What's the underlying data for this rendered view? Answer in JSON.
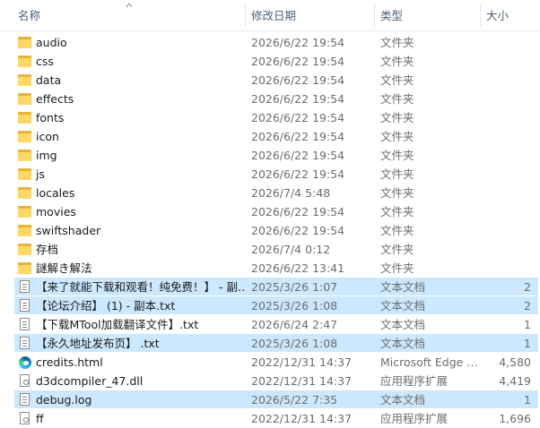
{
  "header": {
    "name": "名称",
    "date": "修改日期",
    "type": "类型",
    "size": "大小"
  },
  "files": [
    {
      "name": "audio",
      "date": "2026/6/22 19:54",
      "type": "文件夹",
      "size": "",
      "icon": "folder-icon",
      "selected": false
    },
    {
      "name": "css",
      "date": "2026/6/22 19:54",
      "type": "文件夹",
      "size": "",
      "icon": "folder-icon",
      "selected": false
    },
    {
      "name": "data",
      "date": "2026/6/22 19:54",
      "type": "文件夹",
      "size": "",
      "icon": "folder-icon",
      "selected": false
    },
    {
      "name": "effects",
      "date": "2026/6/22 19:54",
      "type": "文件夹",
      "size": "",
      "icon": "folder-icon",
      "selected": false
    },
    {
      "name": "fonts",
      "date": "2026/6/22 19:54",
      "type": "文件夹",
      "size": "",
      "icon": "folder-icon",
      "selected": false
    },
    {
      "name": "icon",
      "date": "2026/6/22 19:54",
      "type": "文件夹",
      "size": "",
      "icon": "folder-icon",
      "selected": false
    },
    {
      "name": "img",
      "date": "2026/6/22 19:54",
      "type": "文件夹",
      "size": "",
      "icon": "folder-icon",
      "selected": false
    },
    {
      "name": "js",
      "date": "2026/6/22 19:54",
      "type": "文件夹",
      "size": "",
      "icon": "folder-icon",
      "selected": false
    },
    {
      "name": "locales",
      "date": "2026/7/4 5:48",
      "type": "文件夹",
      "size": "",
      "icon": "folder-icon",
      "selected": false
    },
    {
      "name": "movies",
      "date": "2026/6/22 19:54",
      "type": "文件夹",
      "size": "",
      "icon": "folder-icon",
      "selected": false
    },
    {
      "name": "swiftshader",
      "date": "2026/6/22 19:54",
      "type": "文件夹",
      "size": "",
      "icon": "folder-icon",
      "selected": false
    },
    {
      "name": "存档",
      "date": "2026/7/4 0:12",
      "type": "文件夹",
      "size": "",
      "icon": "folder-icon",
      "selected": false
    },
    {
      "name": "謎解き解法",
      "date": "2026/6/22 13:41",
      "type": "文件夹",
      "size": "",
      "icon": "folder-icon",
      "selected": false
    },
    {
      "name": "【来了就能下载和观看！纯免费！】 - 副…",
      "date": "2025/3/26 1:07",
      "type": "文本文档",
      "size": "2",
      "icon": "text-file-icon",
      "selected": true
    },
    {
      "name": "【论坛介绍】 (1) - 副本.txt",
      "date": "2025/3/26 1:08",
      "type": "文本文档",
      "size": "2",
      "icon": "text-file-icon",
      "selected": true
    },
    {
      "name": "【下载MTool加载翻译文件】.txt",
      "date": "2026/6/24 2:47",
      "type": "文本文档",
      "size": "1",
      "icon": "text-file-icon",
      "selected": false
    },
    {
      "name": "【永久地址发布页】 .txt",
      "date": "2025/3/26 1:08",
      "type": "文本文档",
      "size": "1",
      "icon": "text-file-icon",
      "selected": true
    },
    {
      "name": "credits.html",
      "date": "2022/12/31 14:37",
      "type": "Microsoft Edge …",
      "size": "4,580",
      "icon": "edge-icon",
      "selected": false
    },
    {
      "name": "d3dcompiler_47.dll",
      "date": "2022/12/31 14:37",
      "type": "应用程序扩展",
      "size": "4,419",
      "icon": "dll-file-icon",
      "selected": false
    },
    {
      "name": "debug.log",
      "date": "2026/5/22 7:35",
      "type": "文本文档",
      "size": "1",
      "icon": "text-file-icon",
      "selected": true
    },
    {
      "name": "ff",
      "date": "2022/12/31 14:37",
      "type": "应用程序扩展",
      "size": "1,696",
      "icon": "dll-file-icon",
      "selected": false
    }
  ]
}
